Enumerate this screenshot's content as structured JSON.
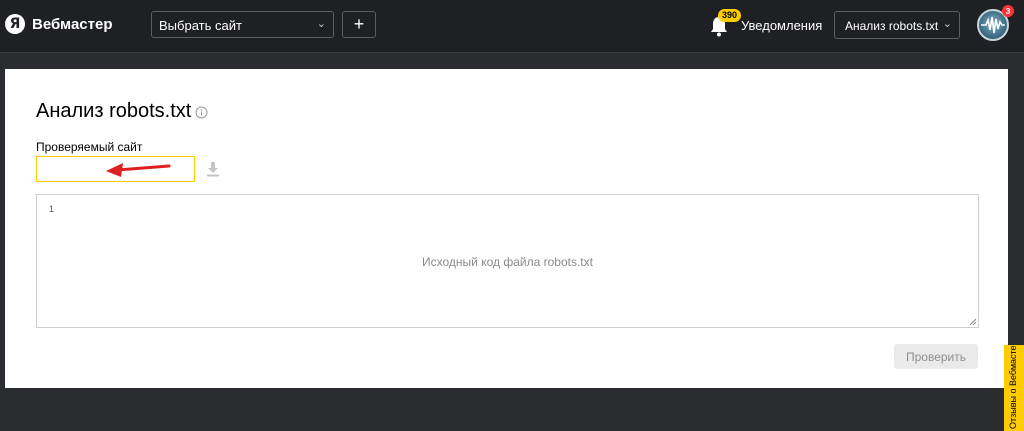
{
  "header": {
    "logo_letter": "Я",
    "app_name": "Вебмастер",
    "site_select_label": "Выбрать сайт",
    "add_button": "+",
    "notifications_count": "390",
    "notifications_label": "Уведомления",
    "tool_select_label": "Анализ robots.txt",
    "avatar_badge": "3"
  },
  "main": {
    "title": "Анализ robots.txt",
    "site_field_label": "Проверяемый сайт",
    "site_field_value": "",
    "editor_line_number": "1",
    "editor_placeholder": "Исходный код файла robots.txt",
    "check_button": "Проверить"
  },
  "feedback_tab": "Отзывы о Вебмастере",
  "colors": {
    "header_bg": "#1f2023",
    "page_bg": "#2b2c30",
    "accent_yellow": "#ffcc00",
    "arrow_red": "#e02020",
    "badge_red": "#ff3333"
  },
  "icons": [
    "yandex-logo-icon",
    "chevron-down-icon",
    "bell-icon",
    "info-icon",
    "download-icon",
    "arrow-annotation",
    "resize-handle-icon"
  ]
}
